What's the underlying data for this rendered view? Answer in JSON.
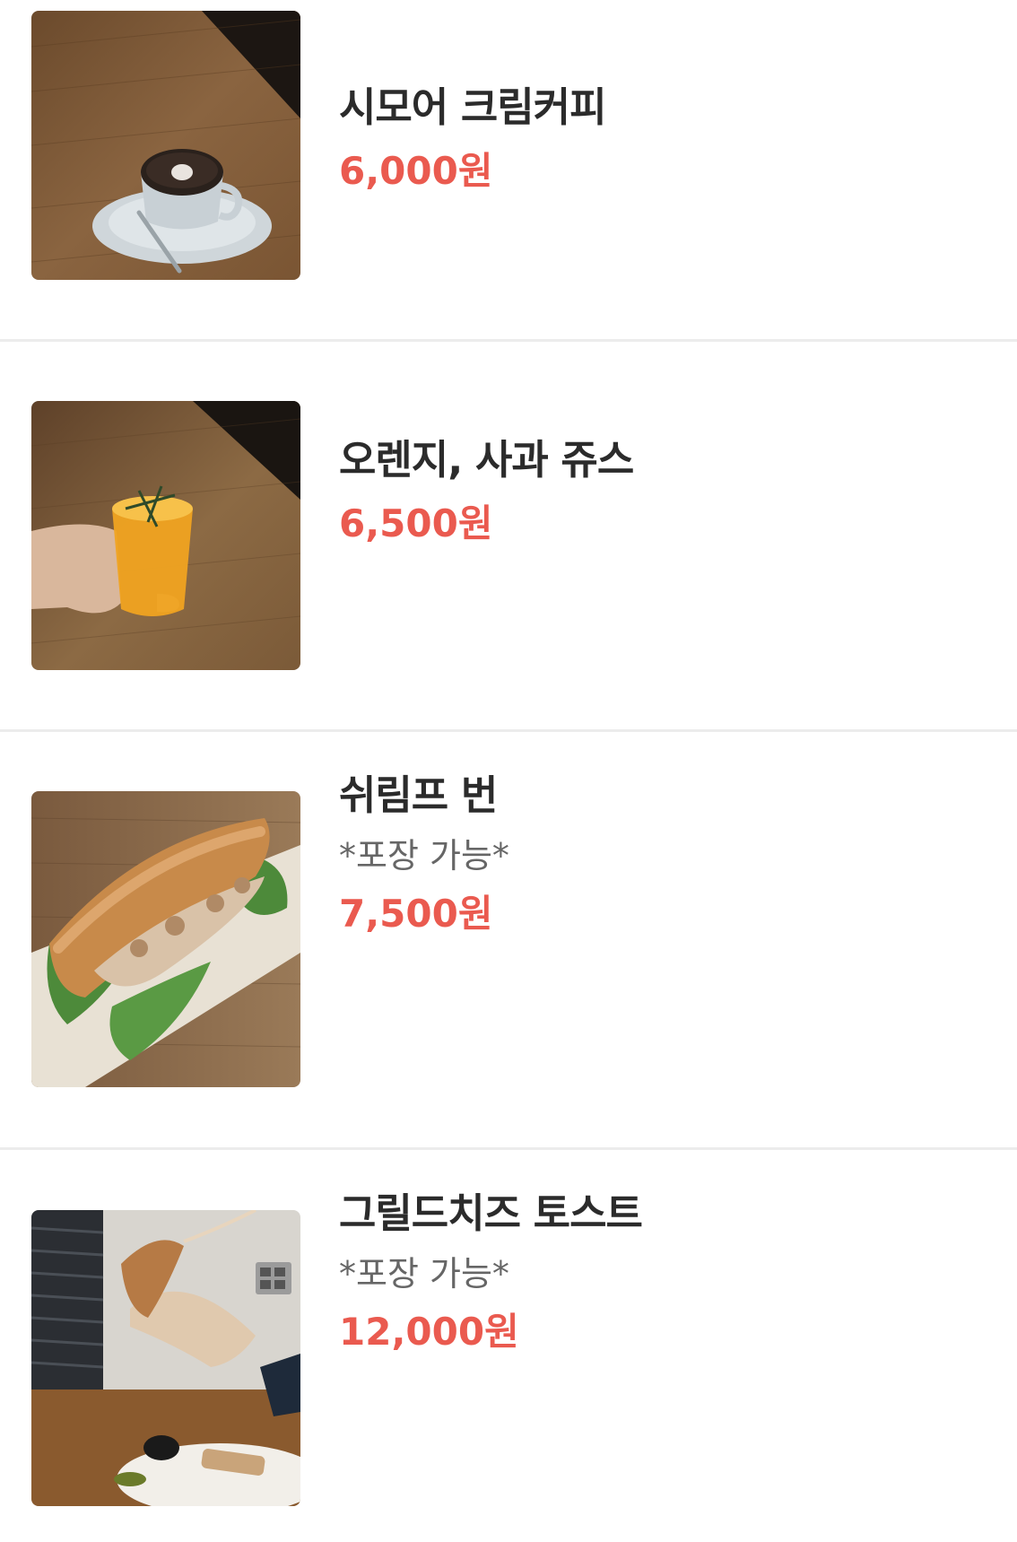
{
  "menu": {
    "items": [
      {
        "name": "시모어 크림커피",
        "note": "",
        "price": "6,000원",
        "image": "cream-coffee-photo"
      },
      {
        "name": "오렌지, 사과 쥬스",
        "note": "",
        "price": "6,500원",
        "image": "orange-juice-photo"
      },
      {
        "name": "쉬림프 번",
        "note": "*포장 가능*",
        "price": "7,500원",
        "image": "shrimp-bun-photo"
      },
      {
        "name": "그릴드치즈 토스트",
        "note": "*포장 가능*",
        "price": "12,000원",
        "image": "grilled-cheese-toast-photo"
      }
    ]
  },
  "colors": {
    "price": "#ea5a4f",
    "name": "#2b2b2b",
    "note": "#666666",
    "divider": "#ececec"
  }
}
